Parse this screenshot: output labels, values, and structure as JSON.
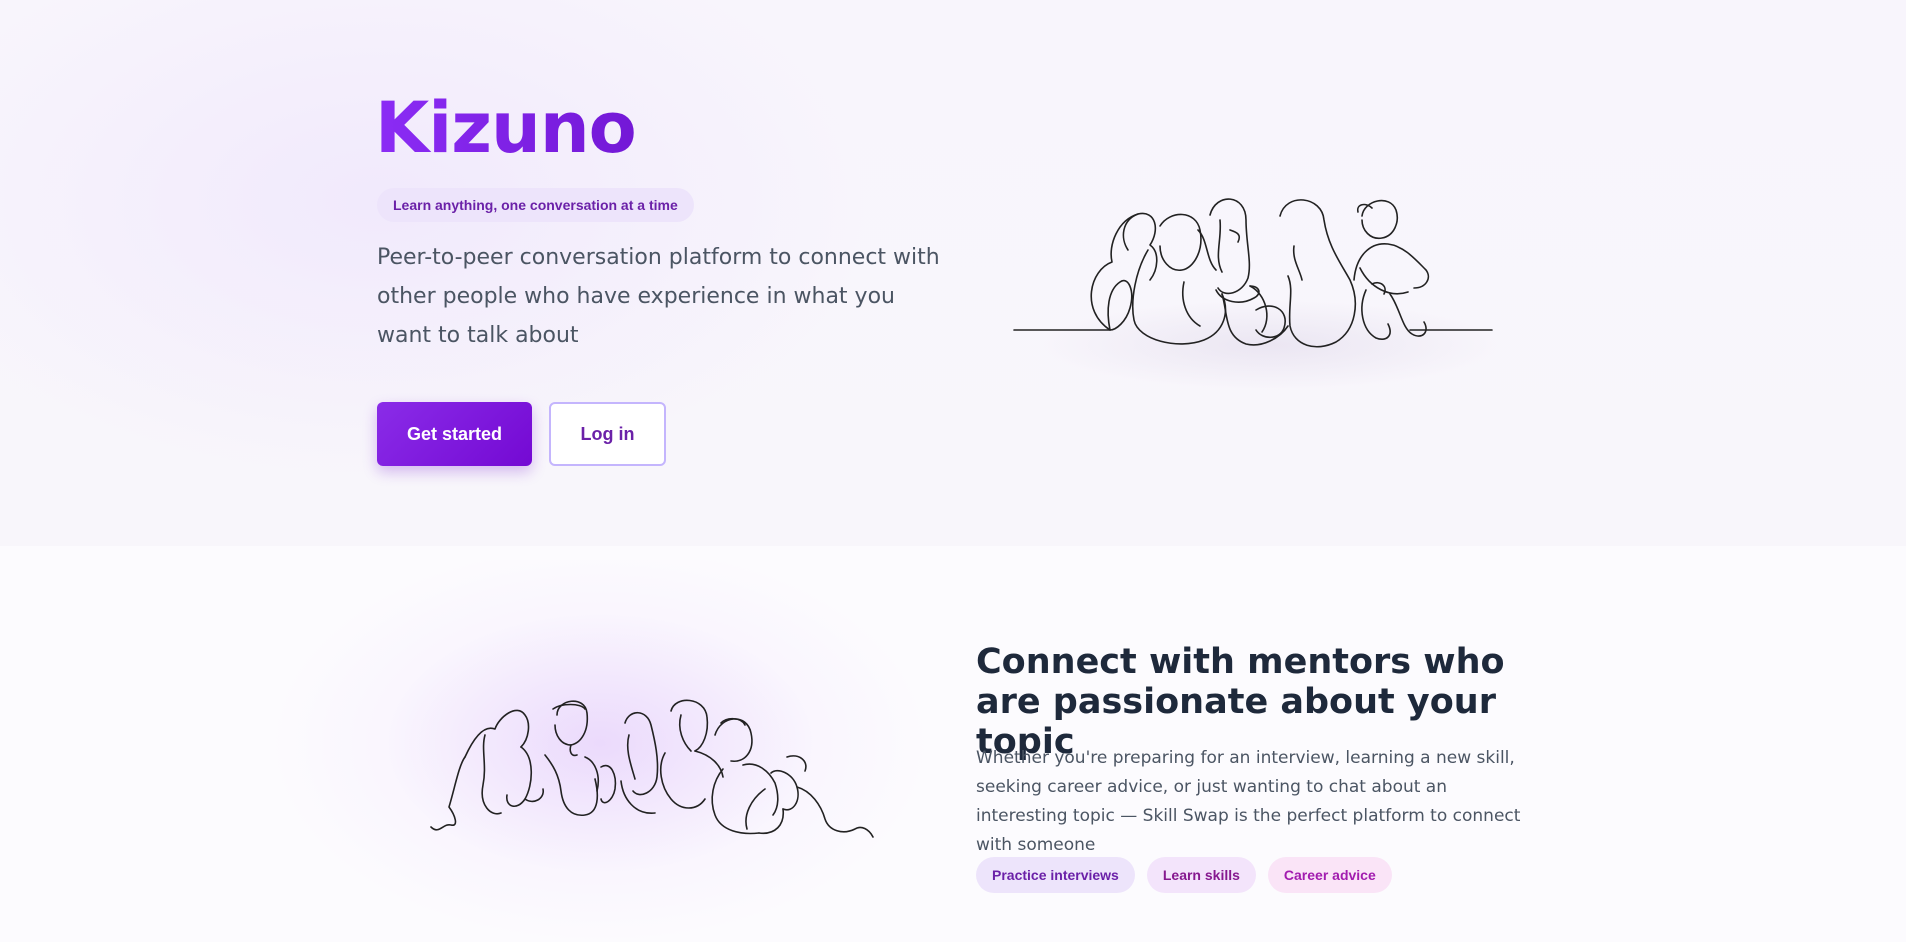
{
  "hero": {
    "brand": "Kizuno",
    "tagline": "Learn anything, one conversation at a time",
    "description": "Peer-to-peer conversation platform to connect with other people who have experience in what you want to talk about",
    "primary_button": "Get started",
    "secondary_button": "Log in",
    "illustration": "people-sitting-line-art"
  },
  "mentors_section": {
    "illustration": "group-line-art",
    "heading": "Connect with mentors who are passionate about your topic",
    "body": "Whether you're preparing for an interview, learning a new skill, seeking career advice, or just wanting to chat about an interesting topic — Skill Swap is the perfect platform to connect with someone",
    "chips": [
      {
        "label": "Practice interviews"
      },
      {
        "label": "Learn skills"
      },
      {
        "label": "Career advice"
      }
    ]
  },
  "colors": {
    "brand_purple": "#7e22ce",
    "button_gradient_start": "#8a2ce8",
    "button_gradient_end": "#7409d3",
    "heading_dark": "#1e293b",
    "body_gray": "#4b5563"
  }
}
